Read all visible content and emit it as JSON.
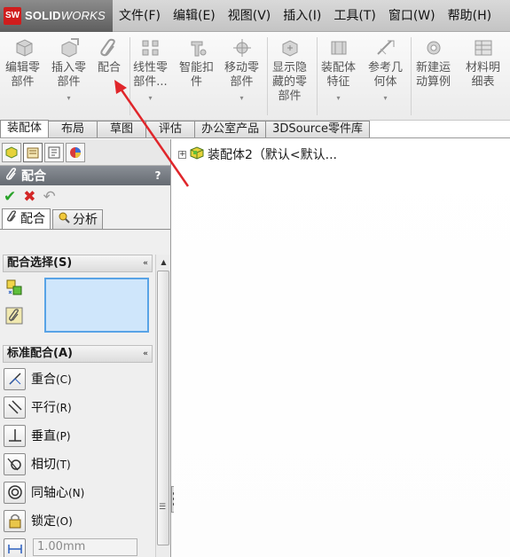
{
  "app": {
    "logo_sw": "SW",
    "logo_solid": "SOLID",
    "logo_works": "WORKS"
  },
  "menu": [
    "文件(F)",
    "编辑(E)",
    "视图(V)",
    "插入(I)",
    "工具(T)",
    "窗口(W)",
    "帮助(H)"
  ],
  "commands": {
    "edit_component": [
      "编辑零",
      "部件"
    ],
    "insert_component": [
      "插入零",
      "部件"
    ],
    "mate": [
      "配合"
    ],
    "linear_pattern": [
      "线性零",
      "部件..."
    ],
    "smart_fasteners": [
      "智能扣",
      "件"
    ],
    "move_component": [
      "移动零",
      "部件"
    ],
    "show_hidden": [
      "显示隐",
      "藏的零",
      "部件"
    ],
    "assembly_features": [
      "装配体",
      "特征"
    ],
    "reference_geometry": [
      "参考几",
      "何体"
    ],
    "new_motion_study": [
      "新建运",
      "动算例"
    ],
    "bom": [
      "材料明",
      "细表"
    ]
  },
  "tabs": [
    "装配体",
    "布局",
    "草图",
    "评估",
    "办公室产品",
    "3DSource零件库"
  ],
  "property_manager": {
    "title": "配合",
    "help": "?",
    "ok": "✔",
    "cancel": "✖",
    "undo": "↶",
    "subtab_mate": "配合",
    "subtab_analysis": "分析",
    "group_selection": "配合选择(S)",
    "group_standard": "标准配合(A)",
    "mates": [
      {
        "label": "重合",
        "key": "(C)"
      },
      {
        "label": "平行",
        "key": "(R)"
      },
      {
        "label": "垂直",
        "key": "(P)"
      },
      {
        "label": "相切",
        "key": "(T)"
      },
      {
        "label": "同轴心",
        "key": "(N)"
      },
      {
        "label": "锁定",
        "key": "(O)"
      }
    ],
    "distance_value": "1.00mm"
  },
  "tree": {
    "node_label": "装配体2（默认<默认..."
  },
  "colors": {
    "accent_red": "#e0262b",
    "selection_fill": "#cfe6fb",
    "selection_border": "#58a3e6",
    "header_gray": "#74797f"
  }
}
